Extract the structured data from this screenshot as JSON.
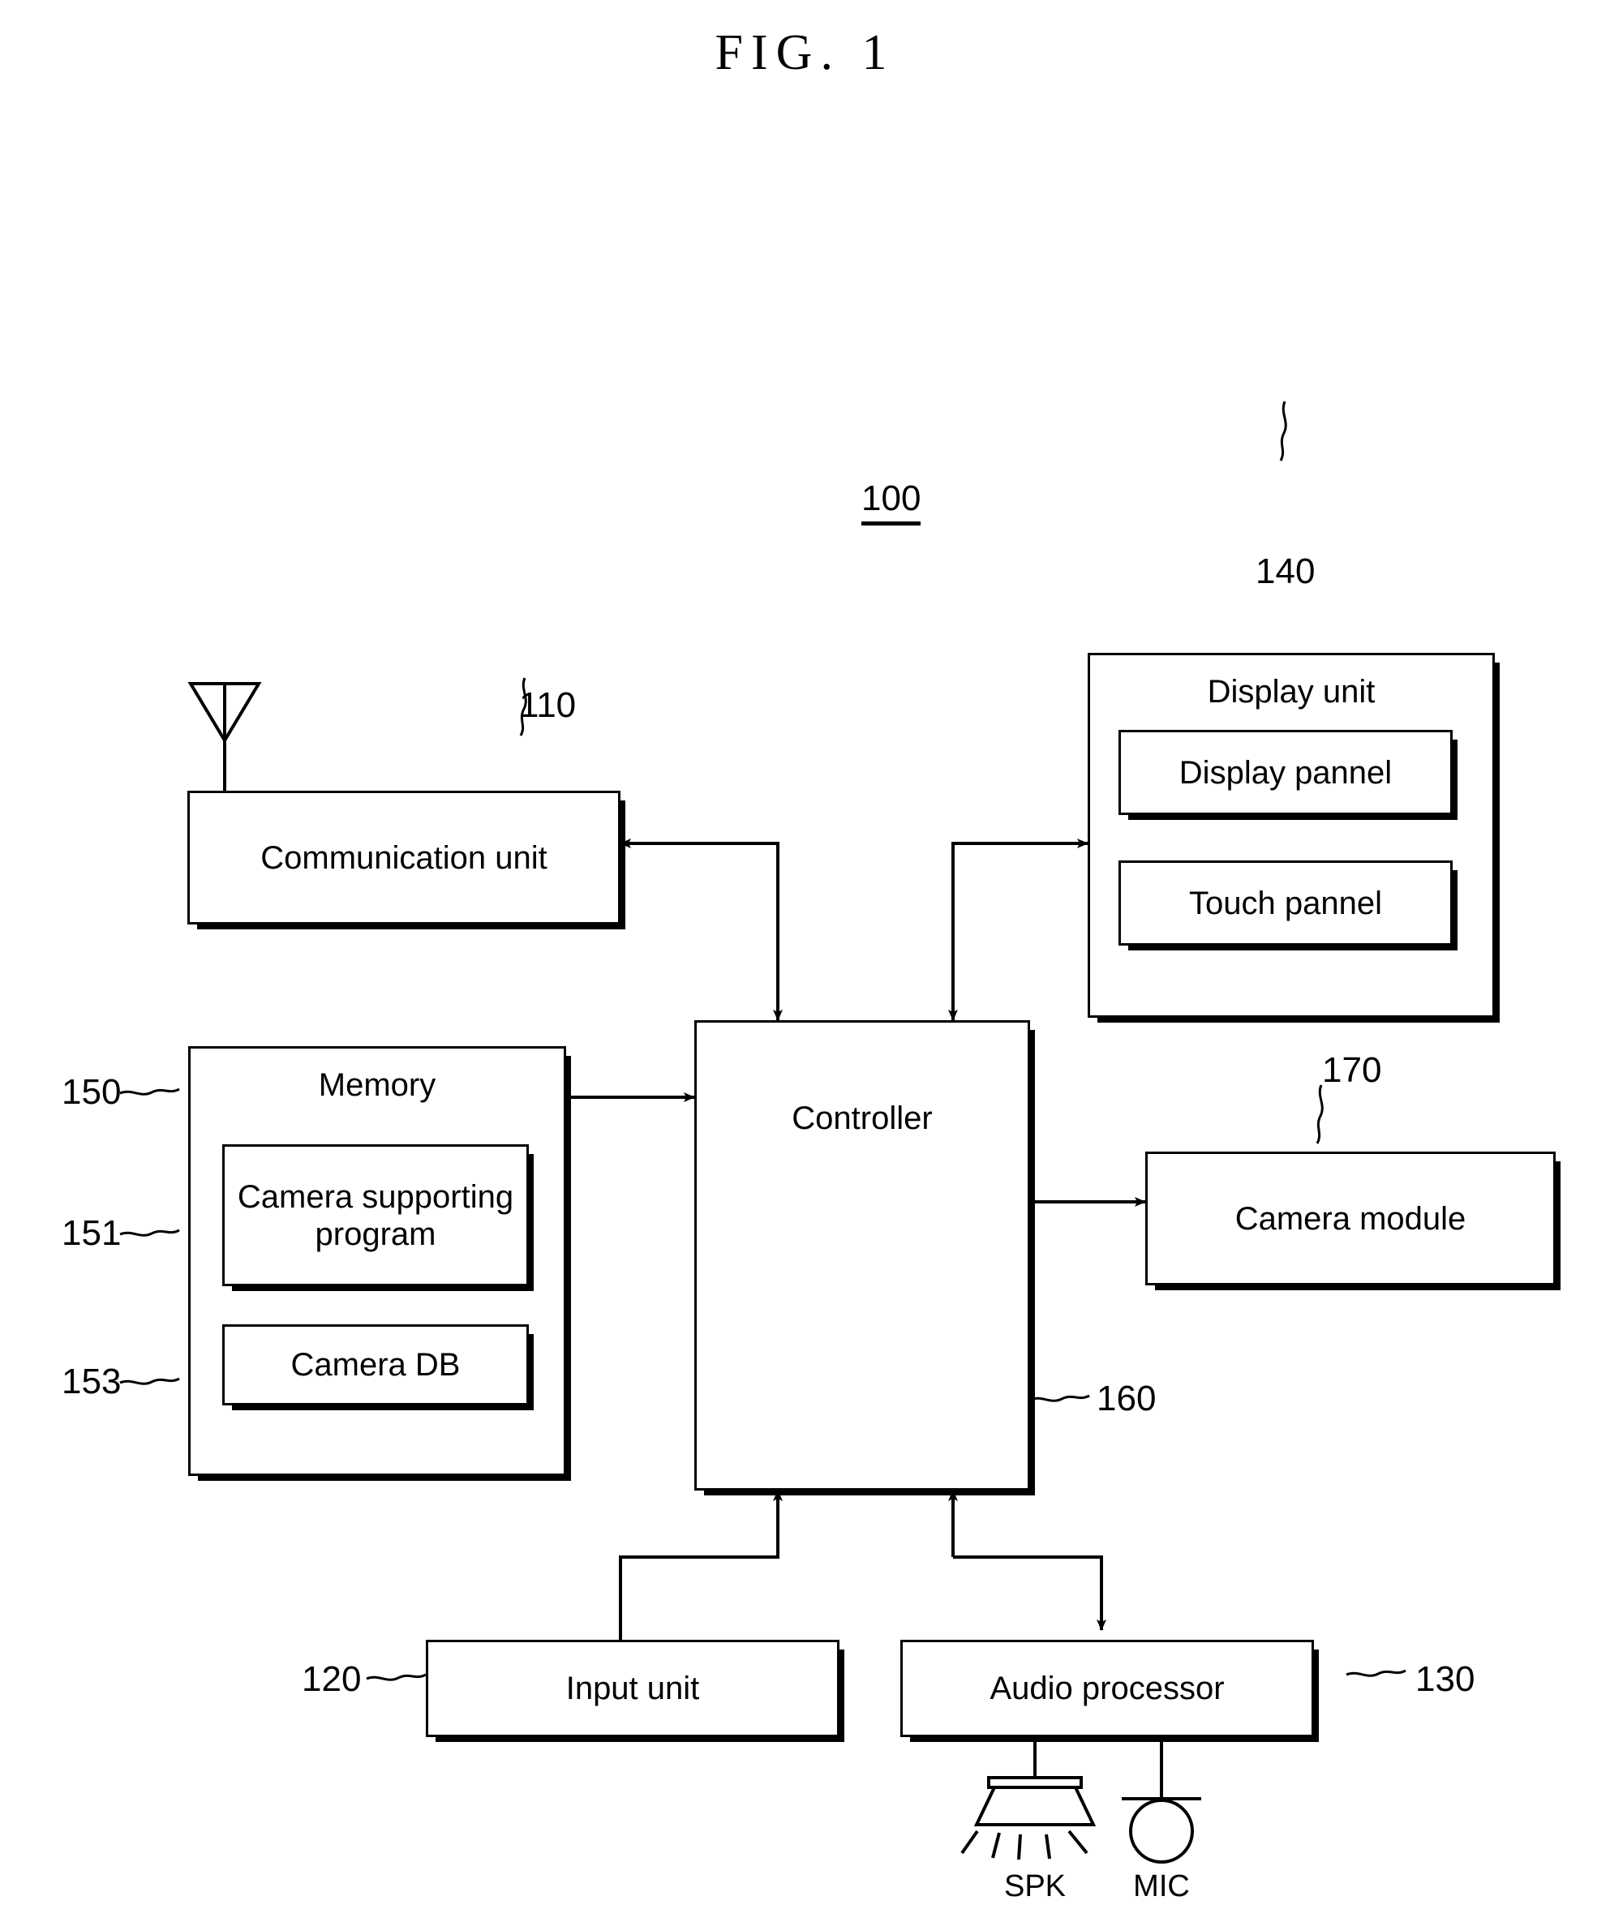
{
  "figure": {
    "title": "FIG. 1",
    "system_ref": "100"
  },
  "blocks": {
    "communication_unit": {
      "label": "Communication unit",
      "ref": "110"
    },
    "input_unit": {
      "label": "Input unit",
      "ref": "120"
    },
    "audio_processor": {
      "label": "Audio processor",
      "ref": "130"
    },
    "display_unit": {
      "label": "Display unit",
      "ref": "140"
    },
    "display_pannel": {
      "label": "Display pannel"
    },
    "touch_pannel": {
      "label": "Touch pannel"
    },
    "memory": {
      "label": "Memory",
      "ref": "150"
    },
    "camera_supporting_program": {
      "label": "Camera supporting\nprogram",
      "ref": "151"
    },
    "camera_db": {
      "label": "Camera DB",
      "ref": "153"
    },
    "controller": {
      "label": "Controller",
      "ref": "160"
    },
    "camera_module": {
      "label": "Camera module",
      "ref": "170"
    }
  },
  "peripherals": {
    "speaker": {
      "label": "SPK"
    },
    "microphone": {
      "label": "MIC"
    },
    "antenna": {
      "icon": "antenna-icon"
    }
  },
  "colors": {
    "stroke": "#000000",
    "background": "#ffffff"
  }
}
